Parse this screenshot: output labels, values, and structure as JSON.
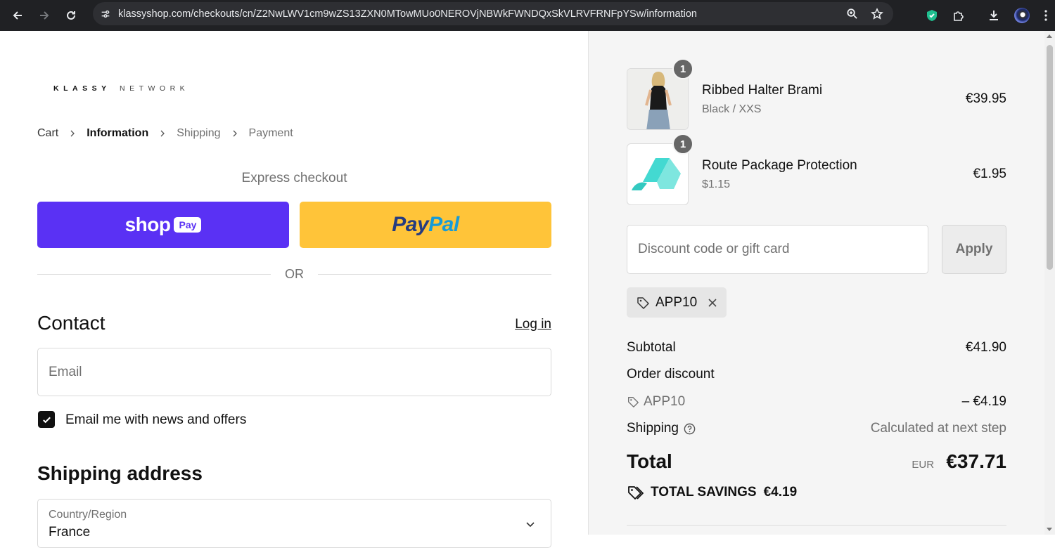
{
  "browser": {
    "url": "klassyshop.com/checkouts/cn/Z2NwLWV1cm9wZS13ZXN0MTowMUo0NEROVjNBWkFWNDQxSkVLRVFRNFpYSw/information"
  },
  "brand": {
    "logo_bold": "KLASSY",
    "logo_light": "NETWORK"
  },
  "breadcrumb": [
    "Cart",
    "Information",
    "Shipping",
    "Payment"
  ],
  "express": {
    "label": "Express checkout",
    "shoppay_word": "shop",
    "shoppay_pill": "Pay",
    "paypal_part1": "Pay",
    "paypal_part2": "Pal",
    "or_text": "OR"
  },
  "contact": {
    "heading": "Contact",
    "login_label": "Log in",
    "email_placeholder": "Email",
    "newsletter_label": "Email me with news and offers",
    "newsletter_checked": true
  },
  "shipping": {
    "heading": "Shipping address",
    "country_label": "Country/Region",
    "country_value": "France"
  },
  "cart": {
    "items": [
      {
        "qty": "1",
        "name": "Ribbed Halter Brami",
        "variant": "Black / XXS",
        "price": "€39.95"
      },
      {
        "qty": "1",
        "name": "Route Package Protection",
        "variant": "$1.15",
        "price": "€1.95"
      }
    ],
    "discount_placeholder": "Discount code or gift card",
    "apply_label": "Apply",
    "applied_code": "APP10"
  },
  "summary": {
    "subtotal_label": "Subtotal",
    "subtotal_value": "€41.90",
    "order_discount_label": "Order discount",
    "discount_code": "APP10",
    "discount_value": "– €4.19",
    "shipping_label": "Shipping",
    "shipping_value": "Calculated at next step",
    "total_label": "Total",
    "currency": "EUR",
    "total_value": "€37.71",
    "savings_label": "TOTAL SAVINGS",
    "savings_value": "€4.19"
  },
  "colors": {
    "shoppay": "#5a31f4",
    "paypal": "#ffc439",
    "summary_bg": "#f5f5f5"
  }
}
